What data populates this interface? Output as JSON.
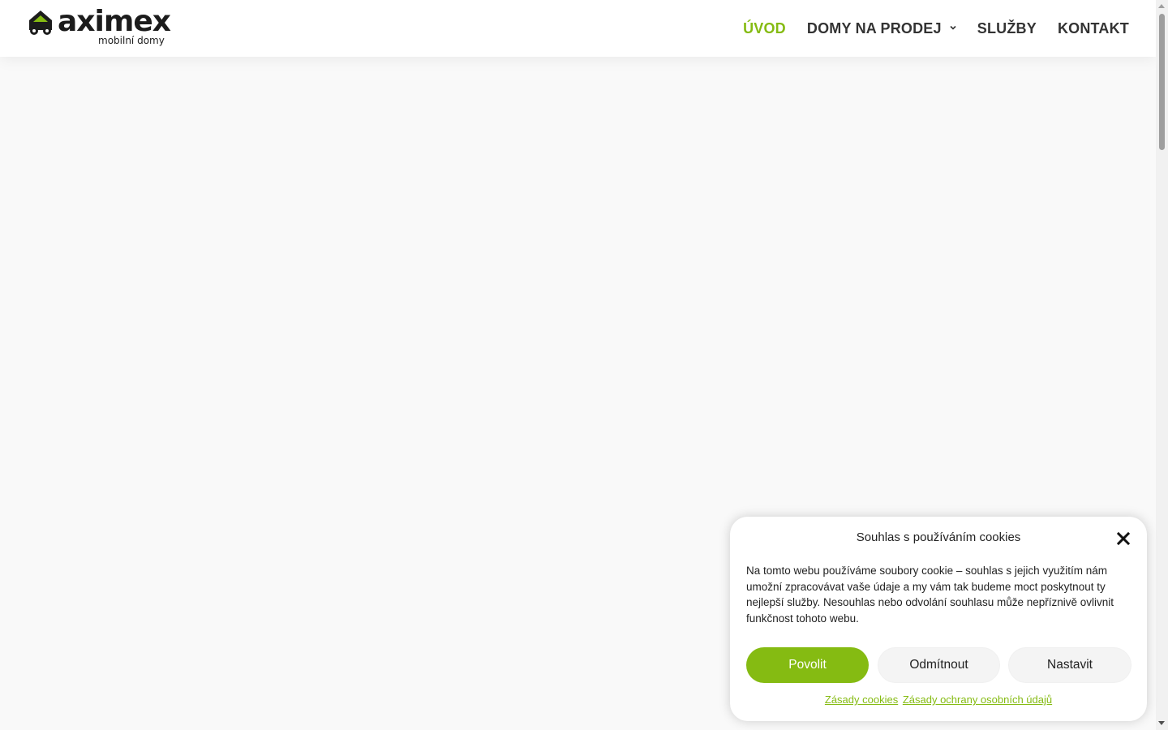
{
  "brand": {
    "name": "aximex",
    "tagline": "mobilní domy",
    "accent_color": "#85bb12",
    "logo_icon": "house-car-icon"
  },
  "nav": {
    "items": [
      {
        "label": "ÚVOD",
        "active": true
      },
      {
        "label": "DOMY NA PRODEJ",
        "has_dropdown": true,
        "icon": "chevron-down-icon"
      },
      {
        "label": "SLUŽBY"
      },
      {
        "label": "KONTAKT"
      }
    ]
  },
  "cookie": {
    "title": "Souhlas s používáním cookies",
    "close_icon": "close-icon",
    "text": "Na tomto webu používáme soubory cookie – souhlas s jejich využitím nám umožní zpracovávat vaše údaje a my vám tak budeme moct poskytnout ty nejlepší služby. Nesouhlas nebo odvolání souhlasu může nepříznivě ovlivnit funkčnost tohoto webu.",
    "accept_label": "Povolit",
    "deny_label": "Odmítnout",
    "settings_label": "Nastavit",
    "links": [
      {
        "label": "Zásady cookies"
      },
      {
        "label": "Zásady ochrany osobních údajů"
      }
    ]
  }
}
